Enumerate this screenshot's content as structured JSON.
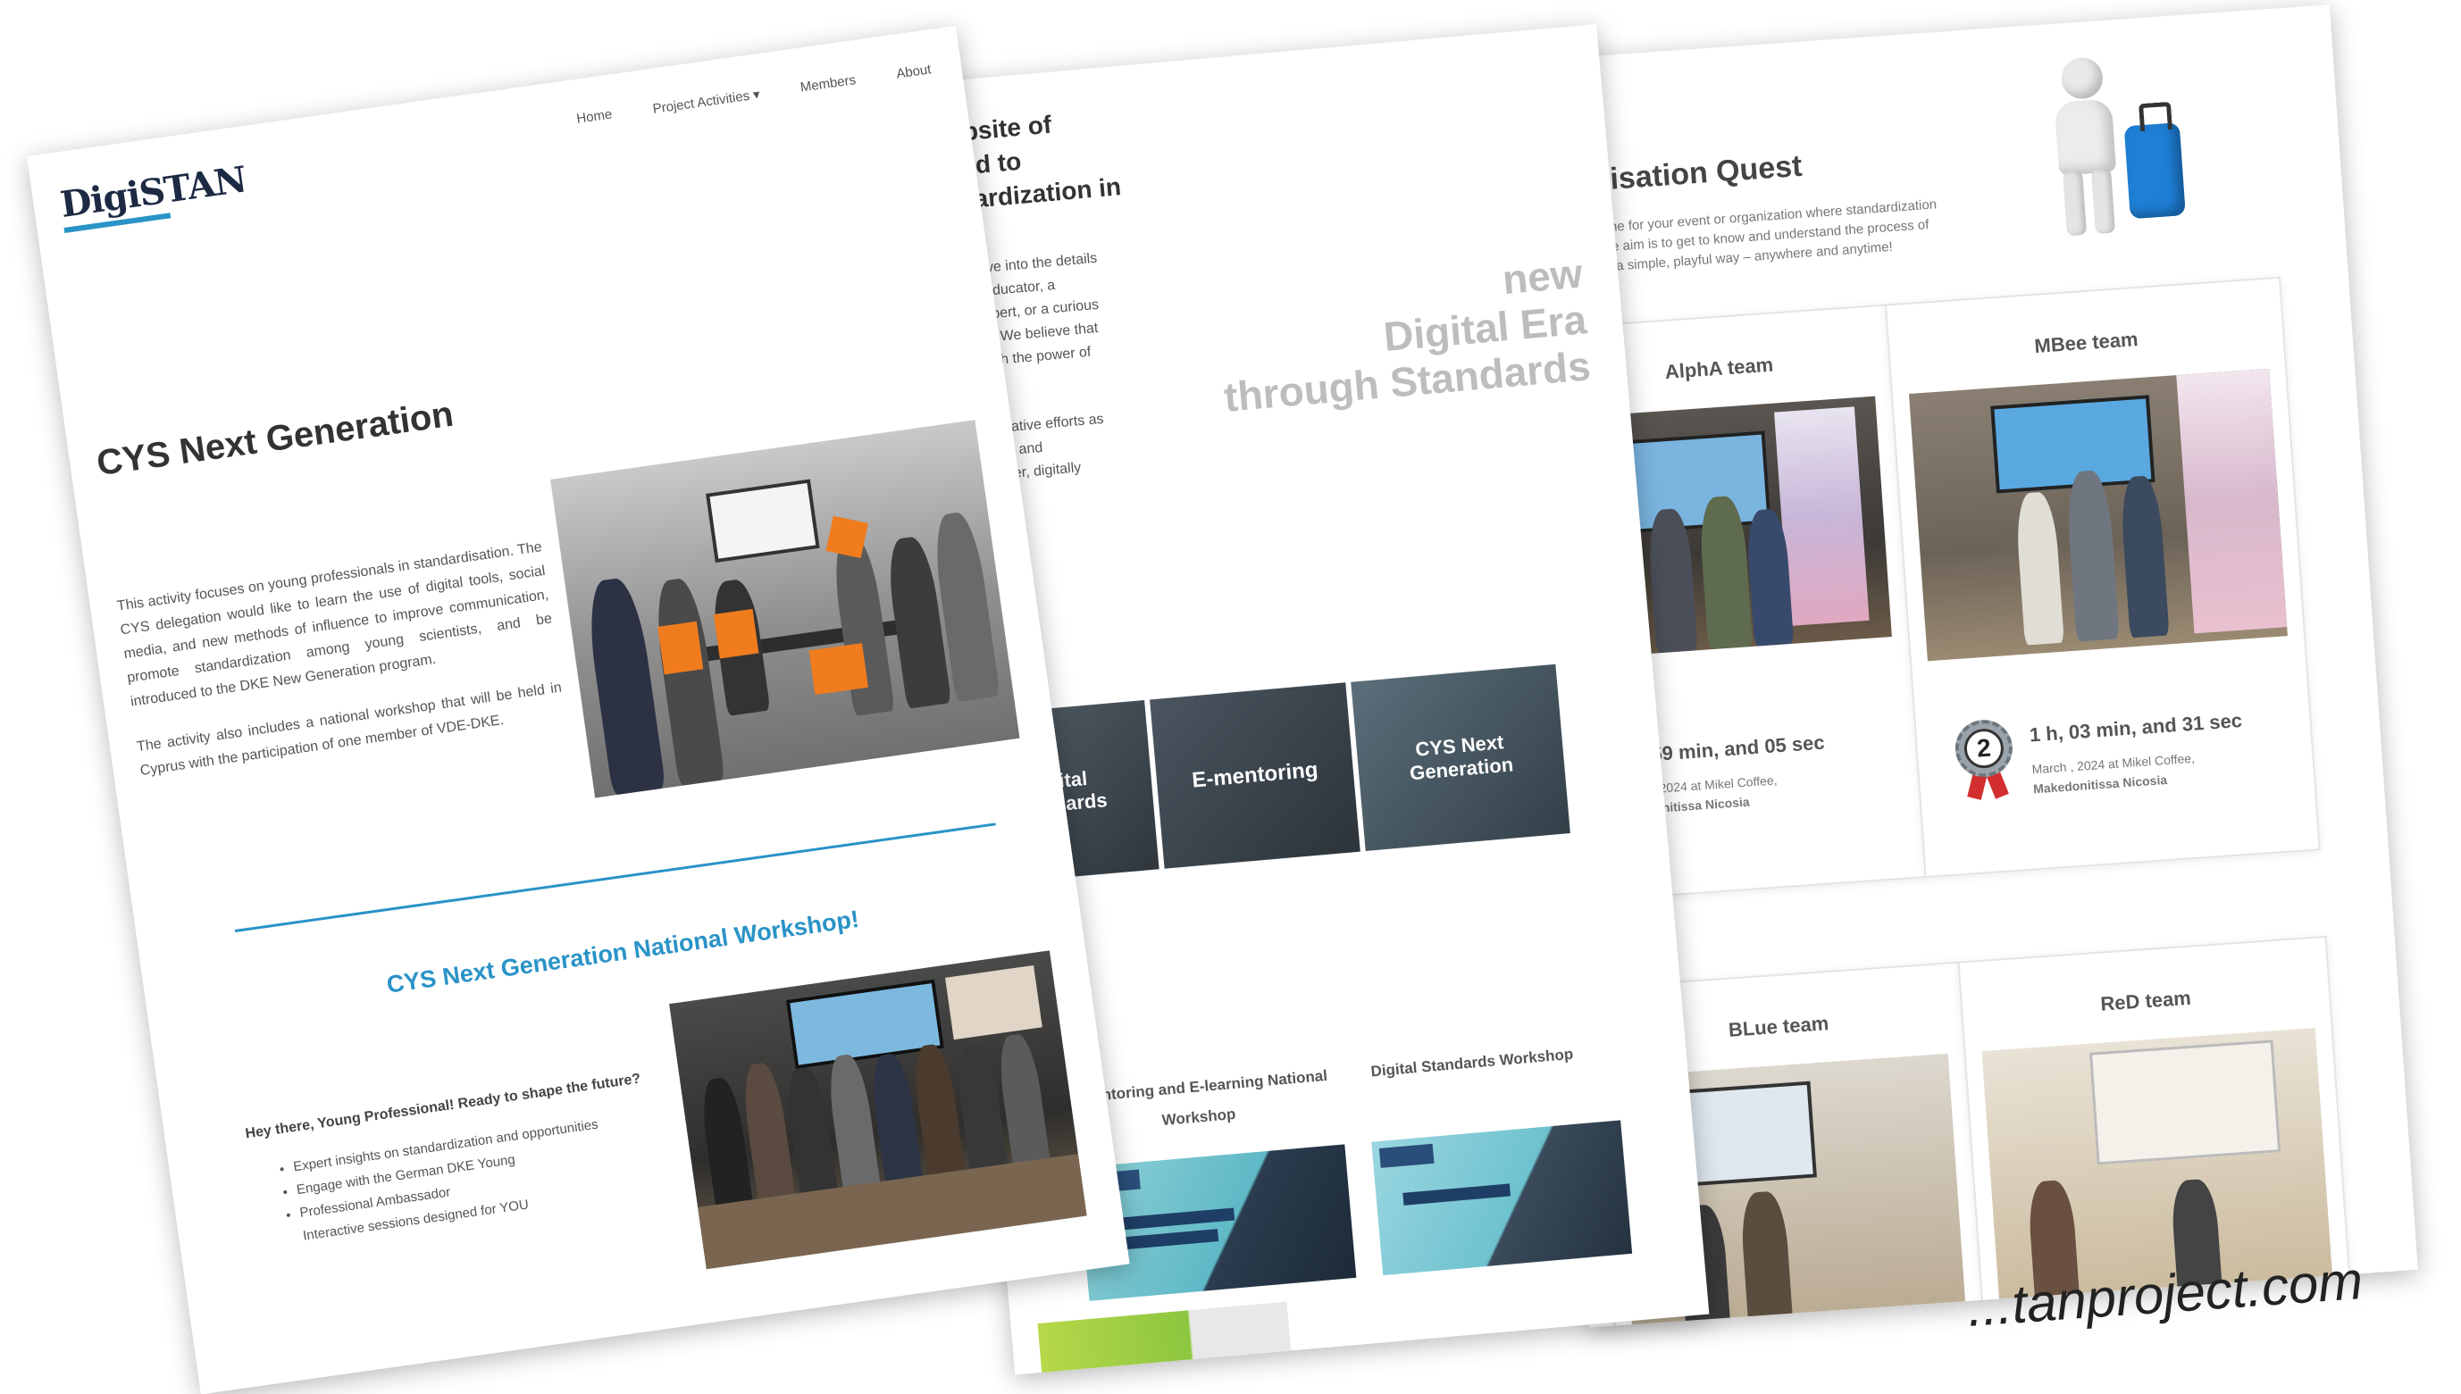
{
  "left": {
    "logo": "DigiSTAN",
    "nav": [
      "Home",
      "Project Activities",
      "Members",
      "About"
    ],
    "nav_caret": "▾",
    "title": "CYS Next Generation",
    "para1": "This activity focuses on young professionals in standardisation. The CYS delegation would like to learn the use of digital tools, social media, and new methods of influence to improve communication, promote standardization among young scientists, and be introduced to the DKE New Generation program.",
    "para2": "The activity also includes a national workshop that will be held in Cyprus with the participation of one member of VDE-DKE.",
    "workshop_title": "CYS Next Generation National Workshop!",
    "lead": "Hey there, Young Professional! Ready to shape the future?",
    "bullets": [
      "Expert insights on standardization and opportunities",
      "Engage with the German DKE Young",
      "Professional Ambassador",
      "Interactive sessions designed for YOU"
    ]
  },
  "middle": {
    "intro_lines": [
      "l website of",
      "icated to",
      "tandardization in"
    ],
    "body_lines": [
      "e and delve into the details",
      "ou're an educator, a",
      "ization expert, or a curious",
      "everyone. We believe that",
      "ure through the power of"
    ],
    "body2_lines": [
      "nd collaborative efforts as",
      "of progress and",
      "for a brighter, digitally",
      "ardization."
    ],
    "hero_lines": [
      "new",
      "Digital Era",
      "through Standards"
    ],
    "tiles": [
      "Digital Standards",
      "E-mentoring",
      "CYS Next Generation"
    ],
    "section_fragment": "p:",
    "workshops": [
      "E-mentoring and E-learning National Workshop",
      "Digital Standards Workshop"
    ]
  },
  "right": {
    "title": "ndartisation Quest",
    "desc_lines": [
      "g puzzle game for your event or organization where standardization",
      "e solved. The aim is to get to know and understand the process of",
      "ardization in a simple, playful way – anywhere and anytime!"
    ],
    "teams": [
      {
        "name": "AlphA team",
        "time": "0 h, 59 min, and 05 sec",
        "meta1": "March , 2024 at Mikel Coffee,",
        "meta2": "Makedonitissa Nicosia"
      },
      {
        "name": "MBee team",
        "time": "1 h, 03 min, and 31 sec",
        "meta1": "March , 2024 at Mikel Coffee,",
        "meta2": "Makedonitissa Nicosia",
        "badge": "2"
      },
      {
        "name": "BLue team"
      },
      {
        "name": "ReD team"
      }
    ]
  },
  "url": "...tanproject.com",
  "colors": {
    "accent": "#2a93c7",
    "orange": "#f07c1e",
    "tile_dark": "#3f4a52",
    "ribbon": "#d32f2f"
  }
}
